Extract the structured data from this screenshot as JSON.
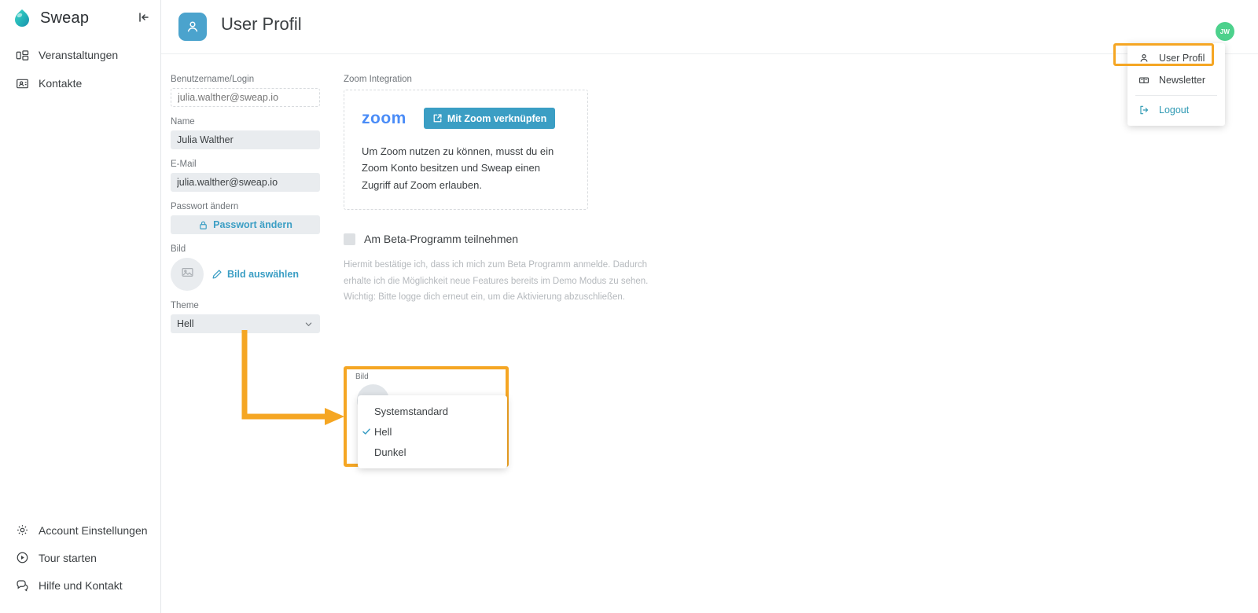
{
  "app": {
    "brand_name": "Sweap",
    "brand_logo_icon": "sweap-drop-logo",
    "collapse_icon": "collapse-sidebar-icon"
  },
  "sidebar": {
    "top_items": [
      {
        "label": "Veranstaltungen",
        "icon": "events-grid-icon"
      },
      {
        "label": "Kontakte",
        "icon": "contacts-card-icon"
      }
    ],
    "bottom_items": [
      {
        "label": "Account Einstellungen",
        "icon": "gear-icon"
      },
      {
        "label": "Tour starten",
        "icon": "play-circle-icon"
      },
      {
        "label": "Hilfe und Kontakt",
        "icon": "chat-bubbles-icon"
      }
    ]
  },
  "header": {
    "title": "User Profil",
    "page_icon": "user-person-icon",
    "avatar_initials": "JW",
    "avatar_color": "#4cd18c",
    "page_icon_color": "#4ba3cd"
  },
  "user_menu": {
    "items": [
      {
        "label": "User Profil",
        "icon": "person-icon",
        "highlighted": true
      },
      {
        "label": "Newsletter",
        "icon": "newsletter-mailbox-icon",
        "highlighted": false
      },
      {
        "label": "Logout",
        "icon": "logout-arrow-icon",
        "highlighted": false
      }
    ],
    "highlight_color": "#f5a623"
  },
  "form": {
    "username": {
      "label": "Benutzername/Login",
      "value": "",
      "placeholder": "julia.walther@sweap.io"
    },
    "name": {
      "label": "Name",
      "value": "Julia Walther"
    },
    "email": {
      "label": "E-Mail",
      "value": "julia.walther@sweap.io"
    },
    "password": {
      "label": "Passwort ändern",
      "button_label": "Passwort ändern",
      "icon": "lock-icon"
    },
    "picture": {
      "label": "Bild",
      "link_label": "Bild auswählen",
      "link_icon": "pencil-icon",
      "placeholder_icon": "image-placeholder-icon"
    },
    "theme": {
      "label": "Theme",
      "value": "Hell",
      "chevron_icon": "chevron-down-icon",
      "options": [
        "Systemstandard",
        "Hell",
        "Dunkel"
      ]
    }
  },
  "zoom_integration": {
    "section_label": "Zoom Integration",
    "logo_text": "zoom",
    "logo_color": "#4a8cf7",
    "connect_button": {
      "label": "Mit Zoom verknüpfen",
      "icon": "external-link-icon",
      "color": "#3b9ec4"
    },
    "description": "Um Zoom nutzen zu können, musst du ein Zoom Konto besitzen und Sweap einen Zugriff auf Zoom erlauben."
  },
  "beta": {
    "checkbox_label": "Am Beta-Programm teilnehmen",
    "checked": false,
    "description": "Hiermit bestätige ich, dass ich mich zum Beta Programm anmelde. Dadurch erhalte ich die Möglichkeit neue Features bereits im Demo Modus zu sehen. Wichtig: Bitte logge dich erneut ein, um die Aktivierung abzuschließen."
  },
  "callout": {
    "border_color": "#f5a623",
    "field_label": "Bild",
    "options": [
      {
        "label": "Systemstandard",
        "selected": false
      },
      {
        "label": "Hell",
        "selected": true
      },
      {
        "label": "Dunkel",
        "selected": false
      }
    ],
    "check_icon": "check-icon"
  },
  "annotation": {
    "arrow_color": "#f5a623",
    "arrow_icon": "elbow-arrow-right-icon"
  }
}
